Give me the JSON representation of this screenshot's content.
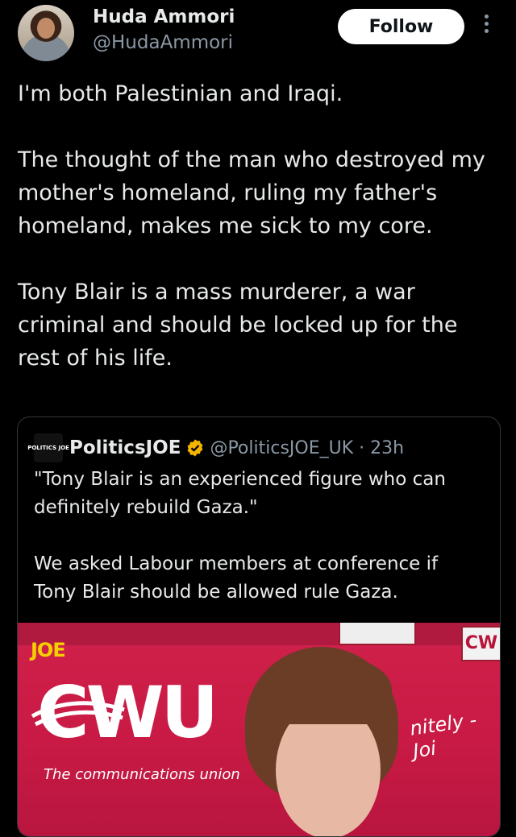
{
  "author": {
    "display_name": "Huda Ammori",
    "handle": "@HudaAmmori",
    "avatar_icon": "profile-photo"
  },
  "actions": {
    "follow_label": "Follow",
    "more_icon": "more-vertical-icon"
  },
  "tweet": {
    "paragraphs": [
      "I'm both Palestinian and Iraqi.",
      "The thought of the man who destroyed my mother's homeland, ruling my father's homeland, makes me sick to my core.",
      "Tony Blair is a mass murderer, a war criminal and should be locked up for the rest of his life."
    ]
  },
  "quoted": {
    "logo_text": "POLITICS JOE",
    "name": "PoliticsJOE",
    "verified_icon": "verified-badge-icon",
    "handle_time": "@PoliticsJOE_UK · 23h",
    "paragraphs": [
      "\"Tony Blair is an experienced figure who can definitely rebuild Gaza.\"",
      "We asked Labour members at conference if Tony Blair should be allowed rule Gaza."
    ],
    "media": {
      "watermark": "JOE",
      "banner_logo": "CWU",
      "banner_tagline": "The communications union",
      "corner_sign": "CW",
      "side_text": "nitely - Joi"
    }
  },
  "colors": {
    "background": "#000000",
    "text": "#e7e9ea",
    "secondary": "#8b98a5",
    "verified": "#f4b400",
    "banner_red": "#c81a44"
  }
}
